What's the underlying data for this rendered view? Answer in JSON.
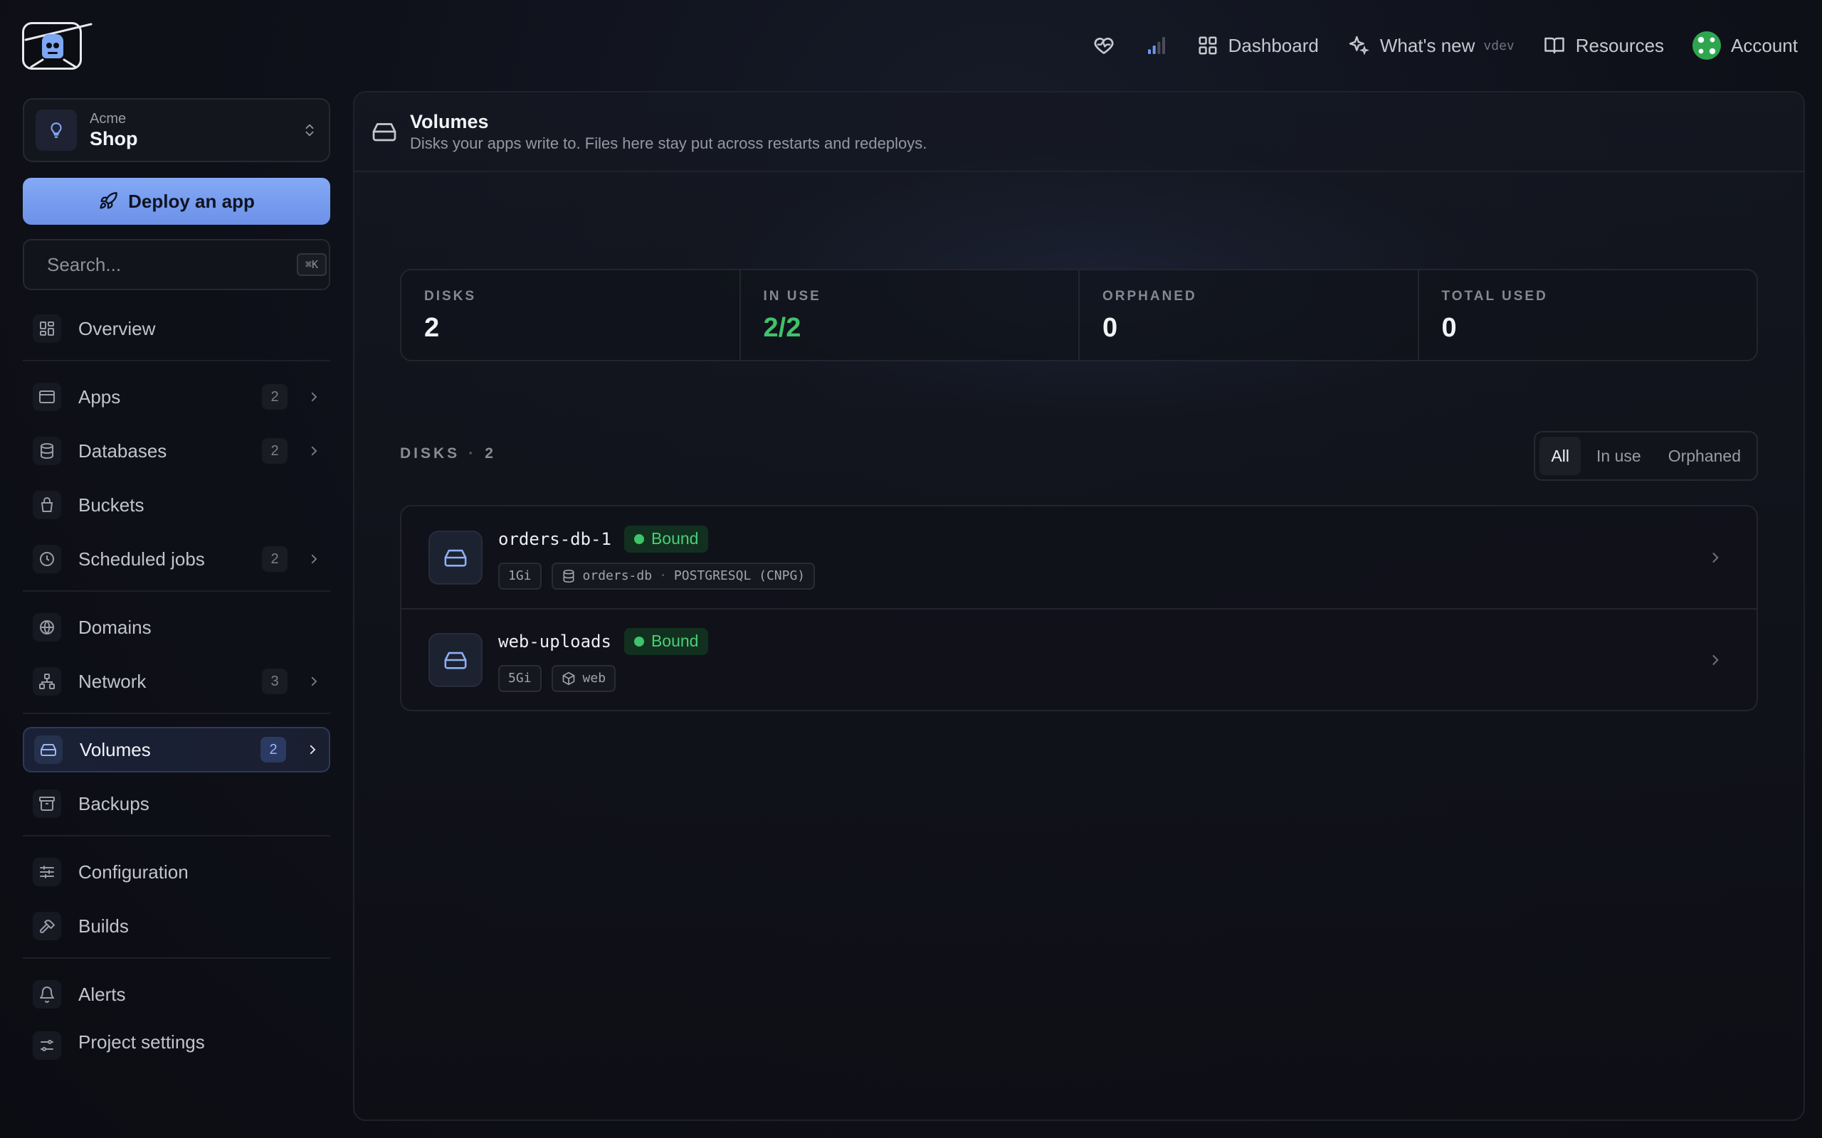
{
  "topbar": {
    "dashboard": "Dashboard",
    "whats_new": "What's new",
    "version": "vdev",
    "resources": "Resources",
    "account": "Account"
  },
  "project": {
    "org": "Acme",
    "name": "Shop"
  },
  "deploy_label": "Deploy an app",
  "search": {
    "placeholder": "Search...",
    "shortcut": "⌘K"
  },
  "nav": {
    "overview": "Overview",
    "apps": {
      "label": "Apps",
      "count": "2"
    },
    "databases": {
      "label": "Databases",
      "count": "2"
    },
    "buckets": "Buckets",
    "scheduled": {
      "label": "Scheduled jobs",
      "count": "2"
    },
    "domains": "Domains",
    "network": {
      "label": "Network",
      "count": "3"
    },
    "volumes": {
      "label": "Volumes",
      "count": "2"
    },
    "backups": "Backups",
    "configuration": "Configuration",
    "builds": "Builds",
    "alerts": "Alerts",
    "project_settings": "Project settings"
  },
  "page": {
    "title": "Volumes",
    "subtitle": "Disks your apps write to. Files here stay put across restarts and redeploys."
  },
  "stats": [
    {
      "label": "DISKS",
      "value": "2"
    },
    {
      "label": "IN USE",
      "value": "2/2"
    },
    {
      "label": "ORPHANED",
      "value": "0"
    },
    {
      "label": "TOTAL USED",
      "value": "0"
    }
  ],
  "section": {
    "title": "DISKS",
    "count": "2"
  },
  "filters": {
    "all": "All",
    "in_use": "In use",
    "orphaned": "Orphaned"
  },
  "disks": [
    {
      "name": "orders-db-1",
      "status": "Bound",
      "size": "1Gi",
      "owner": "orders-db",
      "owner_type": "POSTGRESQL (CNPG)"
    },
    {
      "name": "web-uploads",
      "status": "Bound",
      "size": "5Gi",
      "owner": "web"
    }
  ],
  "colors": {
    "accent": "#7ea6f3",
    "success": "#3fc36b",
    "background": "#0f111a"
  }
}
